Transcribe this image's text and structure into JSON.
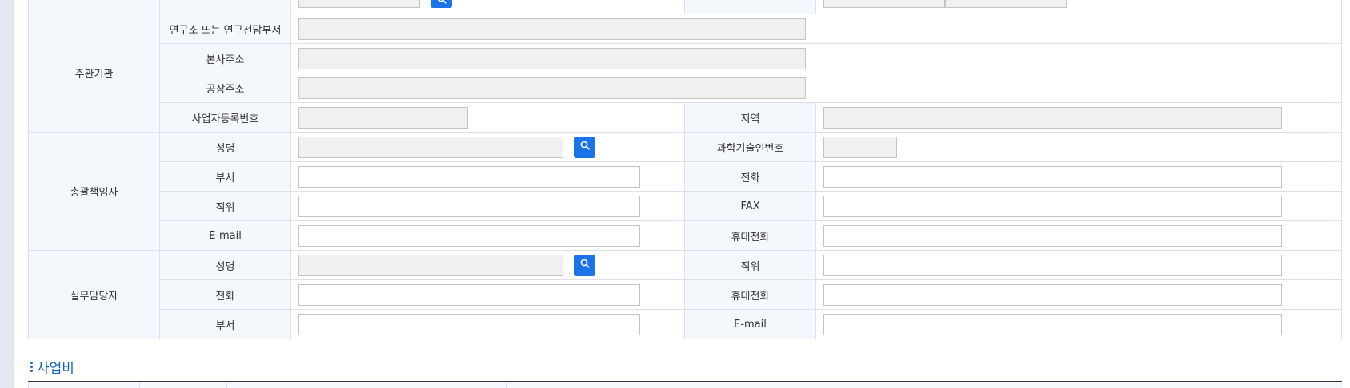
{
  "groups": {
    "host": "주관기관",
    "director": "총괄책임자",
    "staff": "실무담당자"
  },
  "host": {
    "lab_label": "연구소 또는 연구전담부서",
    "hq_address_label": "본사주소",
    "factory_address_label": "공장주소",
    "biz_reg_no_label": "사업자등록번호",
    "region_label": "지역"
  },
  "director": {
    "name_label": "성명",
    "sci_tech_no_label": "과학기술인번호",
    "dept_label": "부서",
    "phone_label": "전화",
    "position_label": "직위",
    "fax_label": "FAX",
    "email_label": "E-mail",
    "mobile_label": "휴대전화"
  },
  "staff": {
    "name_label": "성명",
    "position_label": "직위",
    "phone_label": "전화",
    "mobile_label": "휴대전화",
    "dept_label": "부서",
    "email_label": "E-mail"
  },
  "section": {
    "title": "사업비"
  },
  "colors": {
    "accent": "#1a73e8",
    "section_title": "#1663c7",
    "label_bg": "#f4f7fb",
    "readonly_bg": "#f0f0f0",
    "border": "#dbe0ea"
  },
  "icons": {
    "search": "search-icon"
  }
}
